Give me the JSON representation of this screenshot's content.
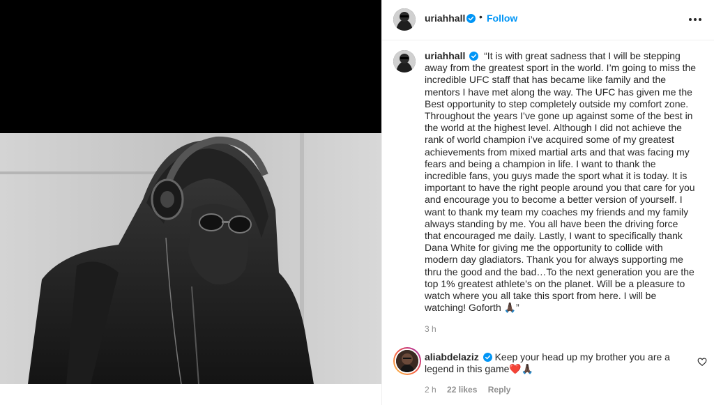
{
  "post": {
    "author": {
      "username": "uriahhall",
      "verified_icon": "verified-badge-icon",
      "follow_label": "Follow",
      "separator": "•"
    },
    "more_options_icon": "more-horizontal-icon",
    "caption": {
      "username": "uriahhall",
      "text": "“It is with great sadness that I will be stepping away from the greatest sport in the world. I’m going to miss the incredible UFC staff that has became like family and the mentors I have met along the way. The UFC has given me the Best opportunity to step completely outside my comfort zone. Throughout the years I’ve gone up against some of the best in the world at the highest level. Although I did not achieve the rank of world champion i’ve acquired some of my greatest achievements from mixed martial arts and that was facing my fears and being a champion in life. I want to thank the incredible fans, you guys made the sport what it is today. It is important to have the right people around you that care for you and encourage you to become a better version of yourself. I want to thank my team my coaches my friends and my family always standing by me. You all have been the driving force that encouraged me daily. Lastly, I want to specifically thank Dana White for giving me the opportunity to collide with modern day gladiators. Thank you for always supporting me thru the good and the bad…To the next generation you are the top 1% greatest athlete’s on the planet. Will be a pleasure to watch where you all take this sport from here. I will be watching! Goforth 🙏🏿”",
      "time": "3 h"
    },
    "comments": [
      {
        "username": "aliabdelaziz",
        "text": "Keep your head up my brother you are a legend in this game❤️🙏🏿",
        "time": "2 h",
        "likes": "22 likes",
        "reply_label": "Reply",
        "like_icon": "heart-outline-icon"
      }
    ]
  },
  "colors": {
    "accent": "#0095f6",
    "text": "#262626",
    "muted": "#8e8e8e",
    "divider": "#efefef"
  }
}
